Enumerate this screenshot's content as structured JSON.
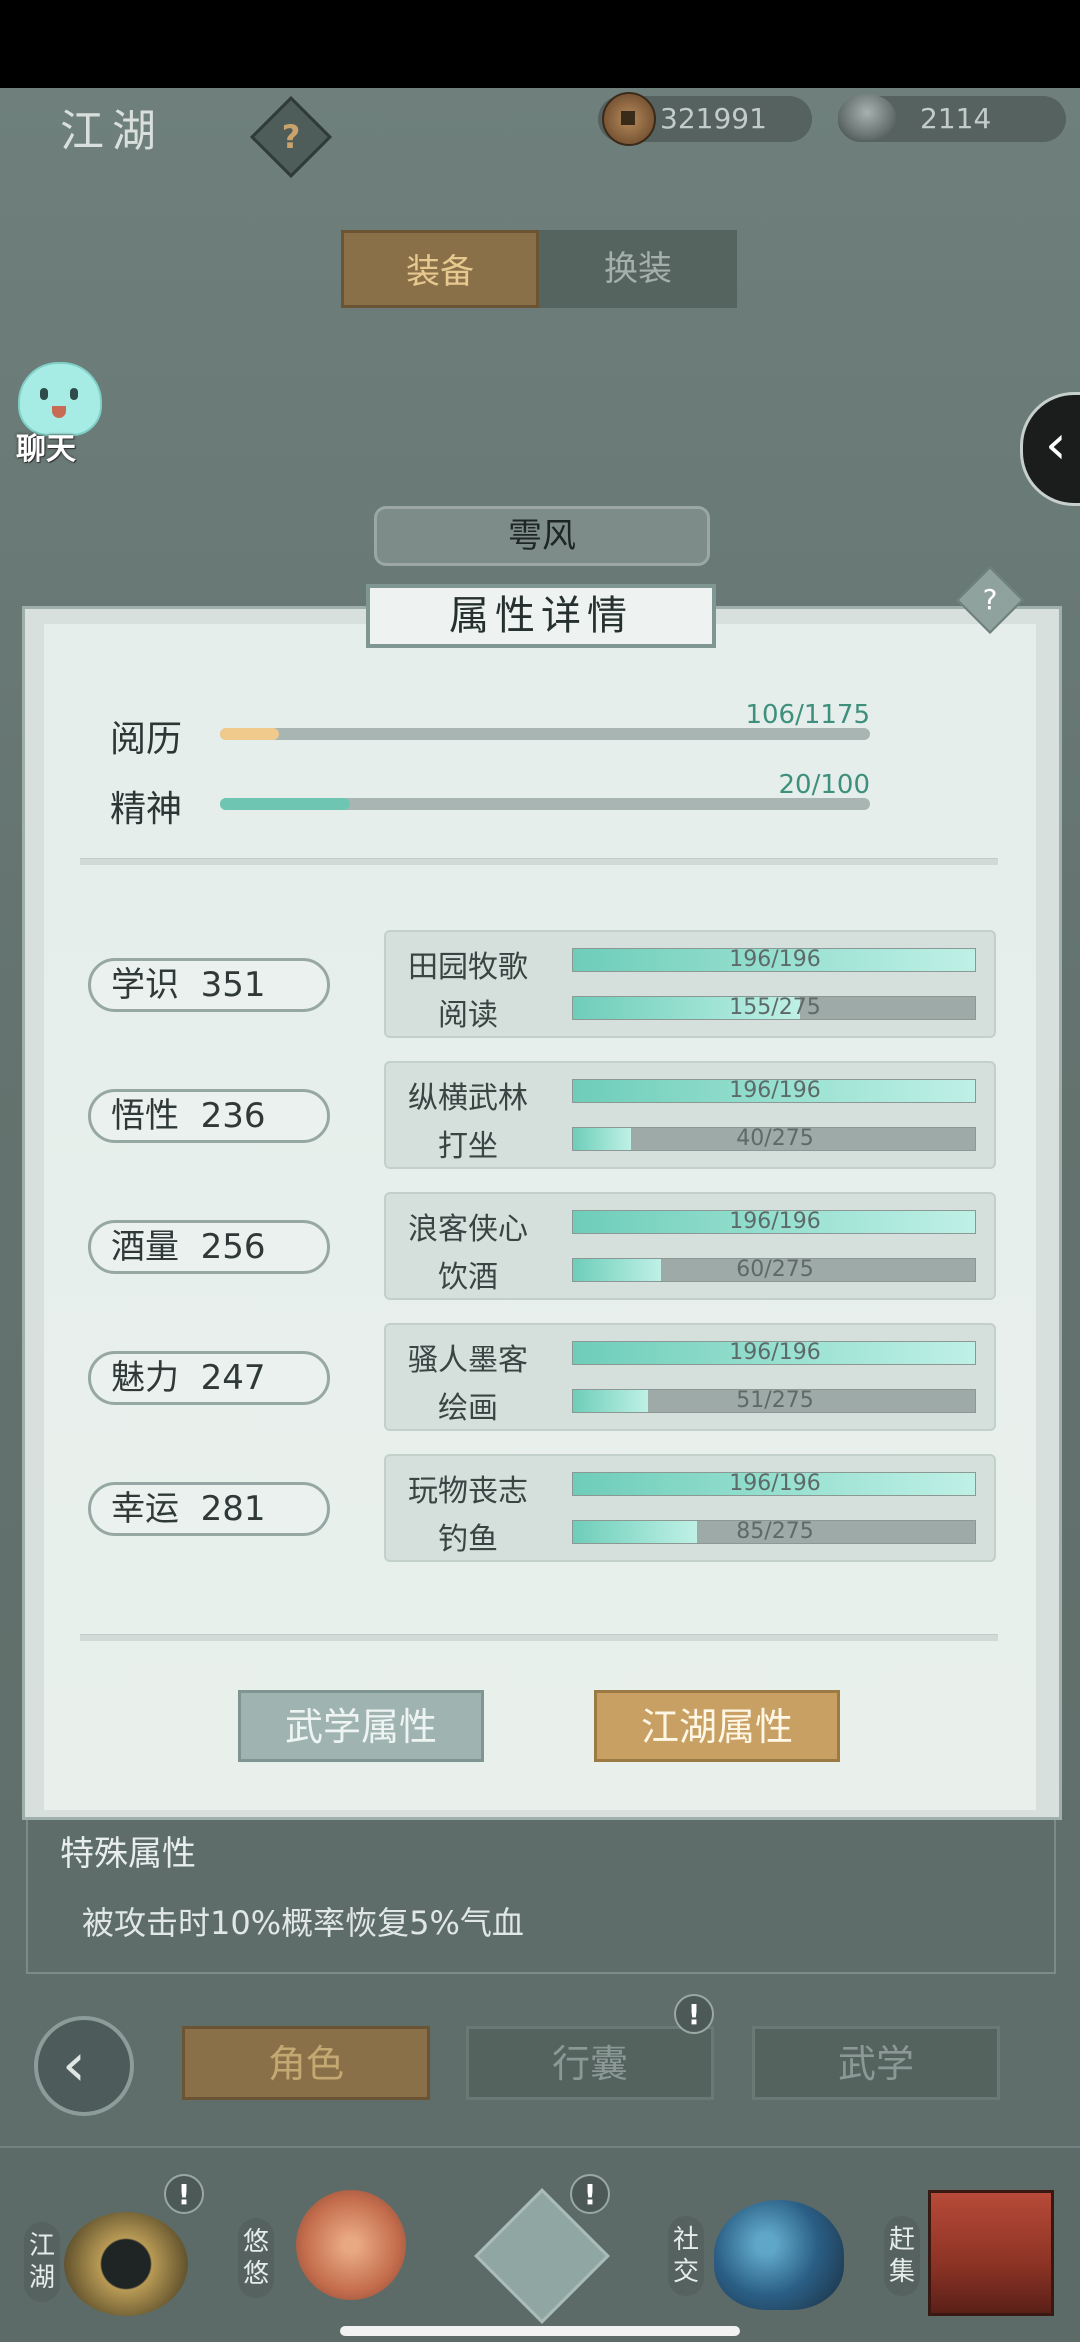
{
  "header": {
    "title": "江湖",
    "help_label": "?",
    "copper_coins": "321991",
    "silver_ingots": "2114"
  },
  "tabs": [
    {
      "label": "装备",
      "active": true
    },
    {
      "label": "换装",
      "active": false
    }
  ],
  "chat": {
    "label": "聊天"
  },
  "side_arrow": "‹",
  "character_name": "雩风",
  "panel": {
    "title": "属性详情",
    "help_label": "?",
    "experience": [
      {
        "label": "阅历",
        "value_text": "106/1175",
        "current": 106,
        "max": 1175,
        "color": "#f0c98c"
      },
      {
        "label": "精神",
        "value_text": "20/100",
        "current": 20,
        "max": 100,
        "color": "#6ec5b2"
      }
    ],
    "attributes": [
      {
        "name": "学识",
        "value": "351",
        "skills": [
          {
            "name": "田园牧歌",
            "value_text": "196/196",
            "current": 196,
            "max": 196
          },
          {
            "name": "阅读",
            "value_text": "155/275",
            "current": 155,
            "max": 275
          }
        ]
      },
      {
        "name": "悟性",
        "value": "236",
        "skills": [
          {
            "name": "纵横武林",
            "value_text": "196/196",
            "current": 196,
            "max": 196
          },
          {
            "name": "打坐",
            "value_text": "40/275",
            "current": 40,
            "max": 275
          }
        ]
      },
      {
        "name": "酒量",
        "value": "256",
        "skills": [
          {
            "name": "浪客侠心",
            "value_text": "196/196",
            "current": 196,
            "max": 196
          },
          {
            "name": "饮酒",
            "value_text": "60/275",
            "current": 60,
            "max": 275
          }
        ]
      },
      {
        "name": "魅力",
        "value": "247",
        "skills": [
          {
            "name": "骚人墨客",
            "value_text": "196/196",
            "current": 196,
            "max": 196
          },
          {
            "name": "绘画",
            "value_text": "51/275",
            "current": 51,
            "max": 275
          }
        ]
      },
      {
        "name": "幸运",
        "value": "281",
        "skills": [
          {
            "name": "玩物丧志",
            "value_text": "196/196",
            "current": 196,
            "max": 196
          },
          {
            "name": "钓鱼",
            "value_text": "85/275",
            "current": 85,
            "max": 275
          }
        ]
      }
    ],
    "buttons": {
      "wuxue": "武学属性",
      "jianghu": "江湖属性"
    }
  },
  "special": {
    "title": "特殊属性",
    "text": "被攻击时10%概率恢复5%气血"
  },
  "nav": {
    "back": "‹",
    "role": "角色",
    "bag": "行囊",
    "martial": "武学",
    "badge": "!"
  },
  "dock": [
    {
      "label": "江湖",
      "badge": "!"
    },
    {
      "label": "悠悠",
      "badge": ""
    },
    {
      "label": "",
      "badge": "!"
    },
    {
      "label": "社交",
      "badge": ""
    },
    {
      "label": "赶集",
      "badge": ""
    }
  ]
}
